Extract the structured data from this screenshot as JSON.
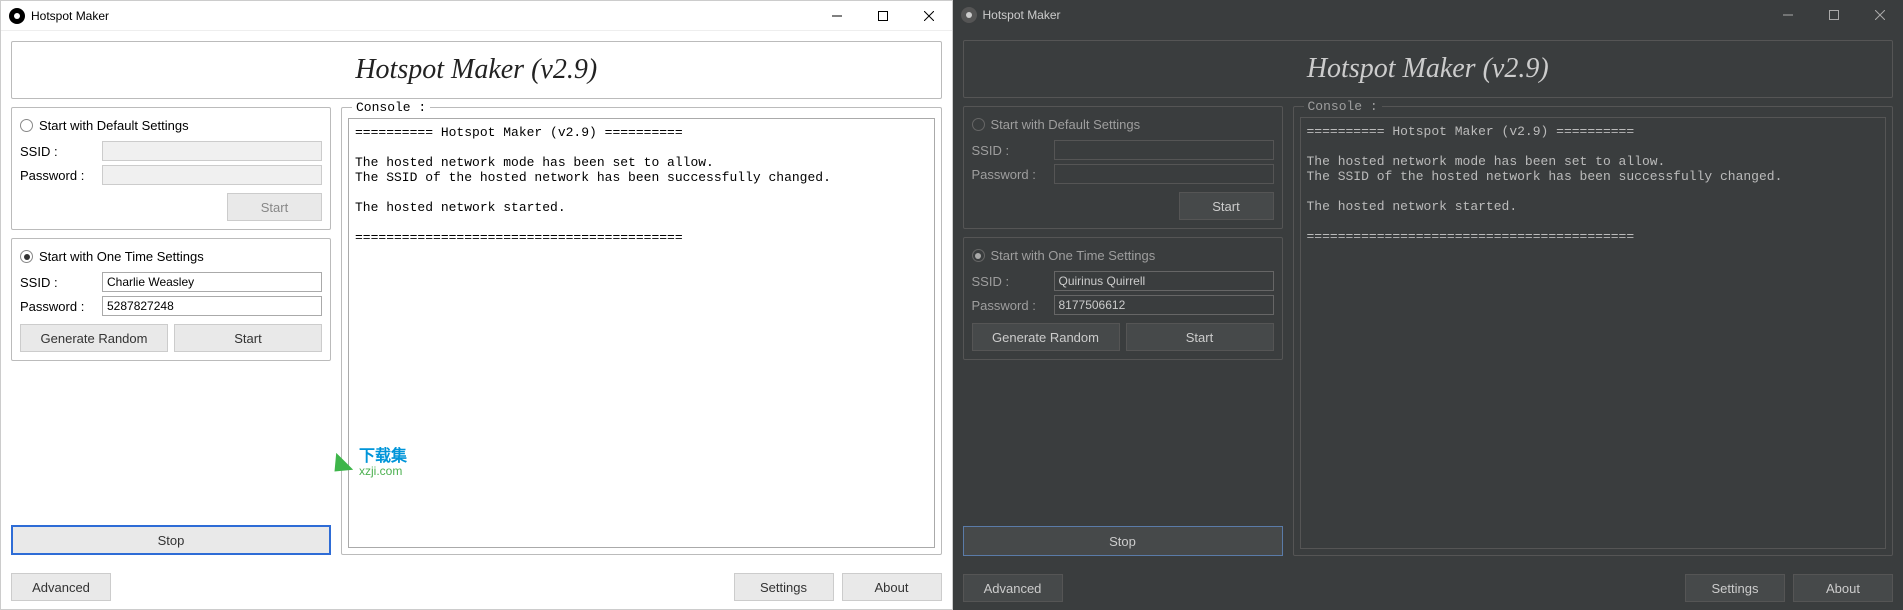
{
  "app": {
    "title": "Hotspot Maker",
    "heading": "Hotspot Maker (v2.9)"
  },
  "sections": {
    "default": {
      "title": "Start with Default Settings",
      "ssid_label": "SSID :",
      "ssid_value": "",
      "password_label": "Password :",
      "password_value": "",
      "start_label": "Start"
    },
    "onetime": {
      "title": "Start with One Time Settings",
      "ssid_label": "SSID :",
      "password_label": "Password :",
      "generate_label": "Generate Random",
      "start_label": "Start"
    }
  },
  "light": {
    "onetime_ssid": "Charlie Weasley",
    "onetime_password": "5287827248"
  },
  "dark": {
    "onetime_ssid": "Quirinus Quirrell",
    "onetime_password": "8177506612"
  },
  "buttons": {
    "stop": "Stop",
    "advanced": "Advanced",
    "settings": "Settings",
    "about": "About"
  },
  "console": {
    "label": "Console :",
    "text": "========== Hotspot Maker (v2.9) ==========\n\nThe hosted network mode has been set to allow.\nThe SSID of the hosted network has been successfully changed.\n\nThe hosted network started.\n\n=========================================="
  },
  "watermark": {
    "cn": "下载集",
    "url": "xzji.com"
  }
}
